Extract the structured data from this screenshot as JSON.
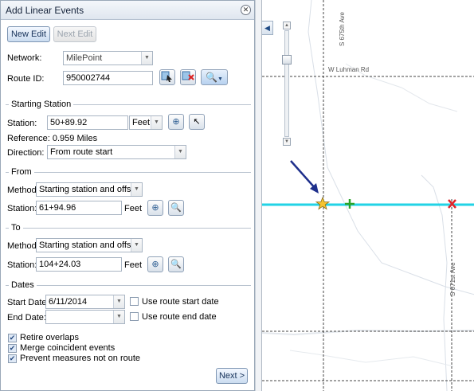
{
  "panel": {
    "title": "Add Linear Events",
    "new_edit": "New Edit",
    "next_edit": "Next Edit",
    "network_label": "Network:",
    "network_value": "MilePoint",
    "route_id_label": "Route ID:",
    "route_id_value": "950002744"
  },
  "starting_station": {
    "legend": "Starting Station",
    "station_label": "Station:",
    "station_value": "50+89.92",
    "units": "Feet",
    "reference": "Reference: 0.959 Miles",
    "direction_label": "Direction:",
    "direction_value": "From route start"
  },
  "from": {
    "legend": "From",
    "method_label": "Method:",
    "method_value": "Starting station and offset",
    "station_label": "Station:",
    "station_value": "61+94.96",
    "units": "Feet"
  },
  "to": {
    "legend": "To",
    "method_label": "Method:",
    "method_value": "Starting station and offset",
    "station_label": "Station:",
    "station_value": "104+24.03",
    "units": "Feet"
  },
  "dates": {
    "legend": "Dates",
    "start_label": "Start Date:",
    "start_value": "6/11/2014",
    "use_start": "Use route start date",
    "end_label": "End Date:",
    "end_value": "",
    "use_end": "Use route end date"
  },
  "options": {
    "retire_overlaps": "Retire overlaps",
    "merge_coincident": "Merge coincident events",
    "prevent_measures": "Prevent measures not on route"
  },
  "footer": {
    "next": "Next >"
  },
  "map": {
    "road_top_label": "S 675th Ave",
    "road_east_label": "W Luhman Rd",
    "road_bottom_label": "S 671st Ave",
    "route_color": "#22d3e6",
    "start_marker": "star",
    "from_marker": "plus",
    "to_marker": "x"
  }
}
